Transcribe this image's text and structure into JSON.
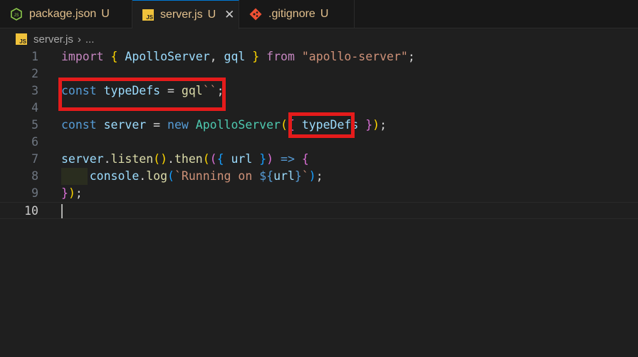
{
  "tabs": [
    {
      "label": "package.json",
      "status": "U",
      "icon": "nodejs-icon",
      "active": false
    },
    {
      "label": "server.js",
      "status": "U",
      "icon": "javascript-icon",
      "active": true,
      "close": "✕"
    },
    {
      "label": ".gitignore",
      "status": "U",
      "icon": "git-icon",
      "active": false
    }
  ],
  "breadcrumb": {
    "file": "server.js",
    "separator": "›",
    "trail": "..."
  },
  "js_badge_text": "JS",
  "editor": {
    "line_numbers": [
      "1",
      "2",
      "3",
      "4",
      "5",
      "6",
      "7",
      "8",
      "9",
      "10"
    ],
    "current_line": 10
  },
  "colors": {
    "modified_text": "#e2c08d",
    "highlight_box": "#e51b1b",
    "active_tab_border": "#0078d4"
  }
}
